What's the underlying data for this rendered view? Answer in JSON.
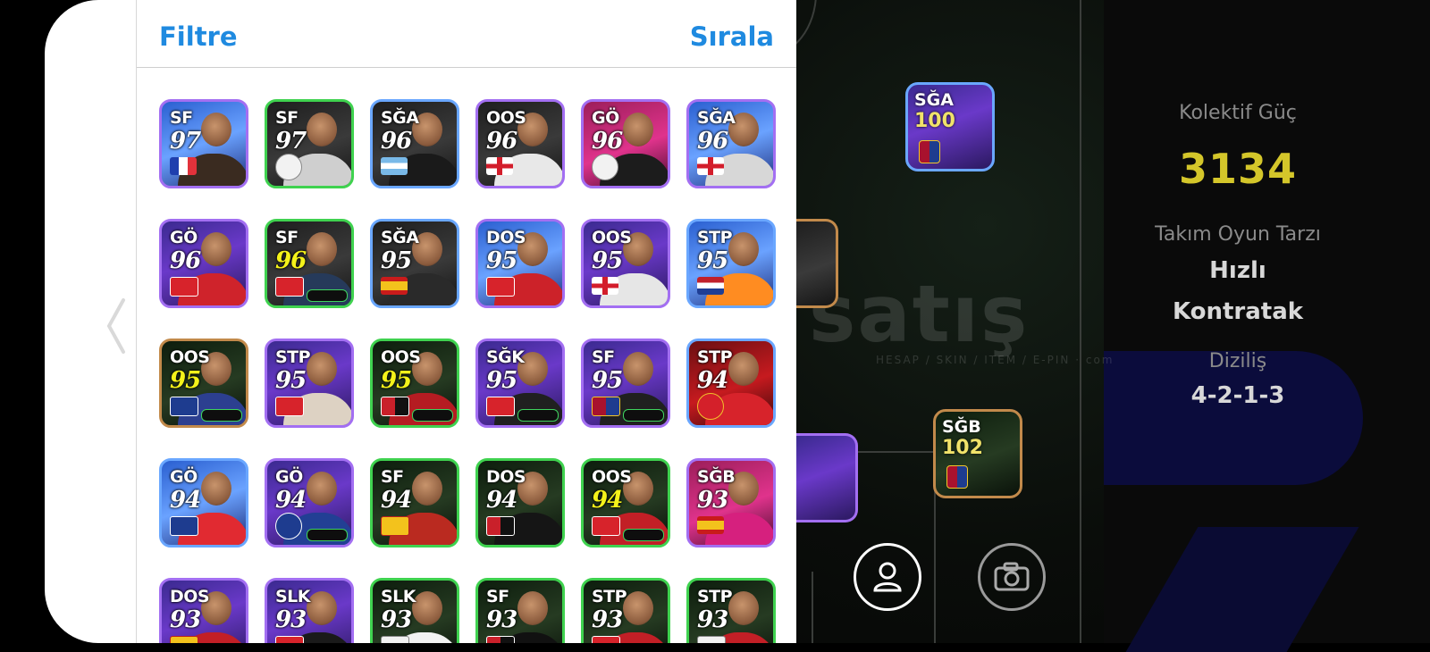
{
  "header": {
    "filter_label": "Filtre",
    "sort_label": "Sırala"
  },
  "team_panel": {
    "power_label": "Kolektif Güç",
    "power_value": "3134",
    "style_label": "Takım Oyun Tarzı",
    "style_value_1": "Hızlı",
    "style_value_2": "Kontratak",
    "formation_label": "Diziliş",
    "formation_value": "4-2-1-3"
  },
  "watermark": {
    "text": "satış",
    "sub": "HESAP / SKIN / ITEM / E-PIN",
    "domain": "com"
  },
  "pitch_cards": [
    {
      "pos": "SĞA",
      "rating": "100"
    },
    {
      "pos": "SĞB",
      "rating": "102"
    }
  ],
  "players": [
    {
      "pos": "SF",
      "rating": "97",
      "emblem": "flag-fr"
    },
    {
      "pos": "SF",
      "rating": "97",
      "emblem": "club-crest"
    },
    {
      "pos": "SĞA",
      "rating": "96",
      "emblem": "flag-ar"
    },
    {
      "pos": "OOS",
      "rating": "96",
      "emblem": "flag-en"
    },
    {
      "pos": "GÖ",
      "rating": "96",
      "emblem": "club-crest"
    },
    {
      "pos": "SĞA",
      "rating": "96",
      "emblem": "flag-en"
    },
    {
      "pos": "GÖ",
      "rating": "96",
      "emblem": "club-crest"
    },
    {
      "pos": "SF",
      "rating": "96",
      "emblem": "club-crest"
    },
    {
      "pos": "SĞA",
      "rating": "95",
      "emblem": "flag-es"
    },
    {
      "pos": "DOS",
      "rating": "95",
      "emblem": "club-crest"
    },
    {
      "pos": "OOS",
      "rating": "95",
      "emblem": "flag-en"
    },
    {
      "pos": "STP",
      "rating": "95",
      "emblem": "flag-nl"
    },
    {
      "pos": "OOS",
      "rating": "95",
      "emblem": "club-crest"
    },
    {
      "pos": "STP",
      "rating": "95",
      "emblem": "club-crest"
    },
    {
      "pos": "OOS",
      "rating": "95",
      "emblem": "club-crest"
    },
    {
      "pos": "SĞK",
      "rating": "95",
      "emblem": "club-crest"
    },
    {
      "pos": "SF",
      "rating": "95",
      "emblem": "club-crest"
    },
    {
      "pos": "STP",
      "rating": "94",
      "emblem": "club-crest"
    },
    {
      "pos": "GÖ",
      "rating": "94",
      "emblem": "club-crest"
    },
    {
      "pos": "GÖ",
      "rating": "94",
      "emblem": "club-crest"
    },
    {
      "pos": "SF",
      "rating": "94",
      "emblem": "club-crest"
    },
    {
      "pos": "DOS",
      "rating": "94",
      "emblem": "club-crest"
    },
    {
      "pos": "OOS",
      "rating": "94",
      "emblem": "club-crest"
    },
    {
      "pos": "SĞB",
      "rating": "93",
      "emblem": "flag-es"
    },
    {
      "pos": "DOS",
      "rating": "93",
      "emblem": "club-crest"
    },
    {
      "pos": "SLK",
      "rating": "93",
      "emblem": "club-crest"
    },
    {
      "pos": "SLK",
      "rating": "93",
      "emblem": "club-crest"
    },
    {
      "pos": "SF",
      "rating": "93",
      "emblem": "club-crest"
    },
    {
      "pos": "STP",
      "rating": "93",
      "emblem": "club-crest"
    },
    {
      "pos": "STP",
      "rating": "93",
      "emblem": "club-crest"
    }
  ],
  "colors": {
    "accent": "#1f8ae0",
    "power": "#d4c62a",
    "highlight_rating": "#f4f21a"
  }
}
